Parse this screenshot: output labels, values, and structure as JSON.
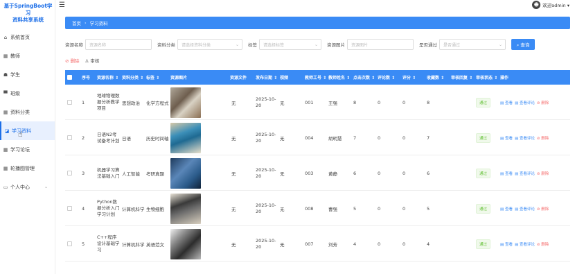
{
  "app": {
    "title_line1": "基于SpringBoot学习",
    "title_line2": "资料共享系统"
  },
  "sidebar": {
    "items": [
      {
        "icon": "⌂",
        "label": "系统首页"
      },
      {
        "icon": "▦",
        "label": "教师"
      },
      {
        "icon": "☗",
        "label": "学生"
      },
      {
        "icon": "▀",
        "label": "班级"
      },
      {
        "icon": "▦",
        "label": "资料分类"
      },
      {
        "icon": "◪",
        "label": "学习资料"
      },
      {
        "icon": "▦",
        "label": "学习论坛"
      },
      {
        "icon": "▦",
        "label": "轮播图管理"
      },
      {
        "icon": "▭",
        "label": "个人中心",
        "arrow": "⌄"
      }
    ]
  },
  "header": {
    "user_label": "欢迎admin ▾",
    "avatar": "☻"
  },
  "breadcrumb": {
    "home": "首页",
    "sep": "›",
    "current": "学习资料"
  },
  "search": {
    "name_label": "资源名称",
    "name_placeholder": "资源名称",
    "cat_label": "资料分类",
    "cat_placeholder": "请选择资料分类",
    "tag_label": "标签",
    "tag_placeholder": "请选择标签",
    "pic_label": "资源图片",
    "pic_placeholder": "资源图片",
    "pass_label": "是否通过",
    "pass_placeholder": "是否通过",
    "query_button": "⌕ 查询"
  },
  "actions": {
    "delete": "⊘ 删除",
    "audit": "♙ 审核"
  },
  "table": {
    "headers": [
      "序号",
      "资源名称 ⇕",
      "资料分类 ⇕",
      "标签 ⇕",
      "资源图片",
      "资源文件",
      "发布日期 ⇕",
      "视频",
      "教师工号 ⇕",
      "教师姓名 ⇕",
      "点击次数 ⇕",
      "评论数 ⇕",
      "评分 ⇕",
      "收藏数 ⇕",
      "审核回复 ⇕",
      "审核状态 ⇕",
      "操作"
    ],
    "rows": [
      {
        "no": "1",
        "name": "地球物理数据分析教学项目",
        "cat": "思想政治",
        "tag": "化学方程式",
        "file": "无",
        "date": "2025-10-20",
        "video": "无",
        "tid": "001",
        "tname": "王强",
        "clicks": "8",
        "comments": "0",
        "score": "0",
        "fav": "8",
        "status": "通过",
        "pic": "p1"
      },
      {
        "no": "2",
        "name": "日语N2考试备考计划",
        "cat": "日语",
        "tag": "历史时间轴",
        "file": "无",
        "date": "2025-10-20",
        "video": "无",
        "tid": "004",
        "tname": "胡明慧",
        "clicks": "7",
        "comments": "0",
        "score": "0",
        "fav": "7",
        "status": "通过",
        "pic": "p2"
      },
      {
        "no": "3",
        "name": "机器学习算法基础入门",
        "cat": "人工智能",
        "tag": "考研真题",
        "file": "无",
        "date": "2025-10-20",
        "video": "无",
        "tid": "003",
        "tname": "黄静",
        "clicks": "6",
        "comments": "0",
        "score": "0",
        "fav": "6",
        "status": "通过",
        "pic": "p3"
      },
      {
        "no": "4",
        "name": "Python数据分析入门学习计划",
        "cat": "计算机科学",
        "tag": "生物细胞",
        "file": "无",
        "date": "2025-10-20",
        "video": "无",
        "tid": "008",
        "tname": "曹强",
        "clicks": "5",
        "comments": "0",
        "score": "0",
        "fav": "5",
        "status": "通过",
        "pic": "p4"
      },
      {
        "no": "5",
        "name": "C++程序设计基础学习",
        "cat": "计算机科学",
        "tag": "英语范文",
        "file": "无",
        "date": "2025-10-20",
        "video": "无",
        "tid": "007",
        "tname": "刘芳",
        "clicks": "4",
        "comments": "0",
        "score": "0",
        "fav": "4",
        "status": "通过",
        "pic": "p5"
      }
    ],
    "ops": {
      "view": "▤ 查看",
      "comment": "▤ 查看评论",
      "delete": "⊘ 删除"
    }
  }
}
